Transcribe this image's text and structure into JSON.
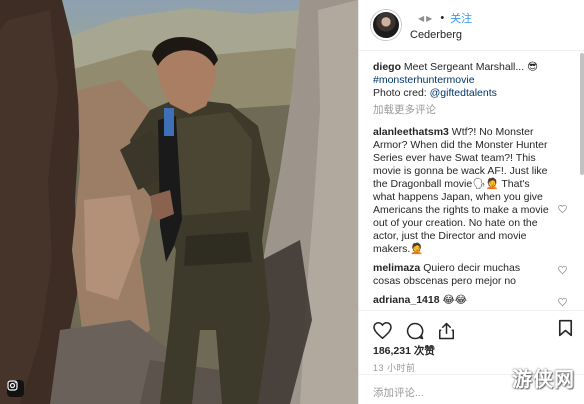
{
  "header": {
    "username": "Cederberg",
    "follow_label": "关注",
    "dot": "•",
    "prev_arrow": "◀",
    "next_arrow": "▶"
  },
  "caption": {
    "username": "diego",
    "text_before": " Meet Sergeant Marshall... ",
    "emoji_text": "😎",
    "hashtag": "#monsterhuntermovie",
    "photo_cred_label": "Photo cred: ",
    "photo_cred_handle": "@giftedtalents"
  },
  "load_more_label": "加载更多评论",
  "comments": [
    {
      "username": "alanleethatsm3",
      "text": " Wtf?! No Monster Armor? When did the Monster Hunter Series ever have Swat team?! This movie is gonna be wack AF!. Just like the Dragonball movie🗣🤦 That's what happens Japan, when you give Americans the rights to make a movie out of your creation. No hate on the actor, just the Director and movie makers.🤦"
    },
    {
      "username": "melimaza",
      "text": " Quiero decir muchas cosas obscenas pero mejor no"
    },
    {
      "username": "adriana_1418",
      "text": " 😂😂"
    }
  ],
  "icons": {
    "like": "heart-icon",
    "comment": "comment-icon",
    "share": "share-icon",
    "save": "bookmark-icon",
    "photo_corner": "instagram-glyph-icon"
  },
  "likes_text": "186,231 次赞",
  "time_text": "13 小时前",
  "add_comment_placeholder": "添加评论...",
  "watermark": "游侠网",
  "colors": {
    "link_blue": "#3897f0",
    "hashtag_dark": "#003569",
    "muted": "#999999",
    "text": "#262626"
  }
}
